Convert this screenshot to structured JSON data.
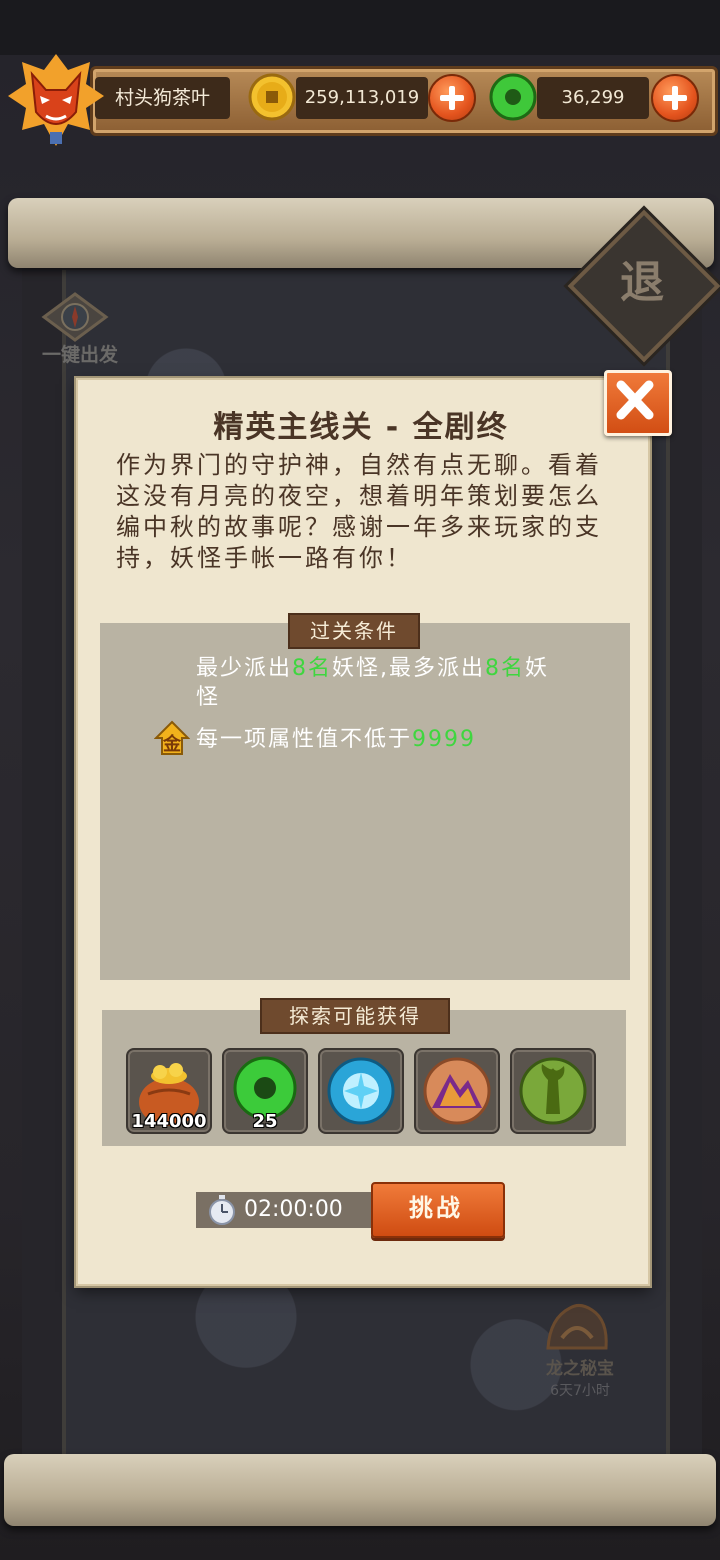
{
  "header": {
    "player_name": "村头狗茶叶",
    "coins": "259,113,019",
    "jade": "36,299"
  },
  "background": {
    "retreat_label": "退",
    "one_click_label": "一键出发",
    "event_title": "龙之秘宝",
    "event_timer": "6天7小时"
  },
  "modal": {
    "title": "精英主线关 - 全剧终",
    "description": "作为界门的守护神，自然有点无聊。看着这没有月亮的夜空，想着明年策划要怎么编中秋的故事呢？感谢一年多来玩家的支持，妖怪手帐一路有你！",
    "conditions_header": "过关条件",
    "condition1": {
      "part1": "最少派出",
      "count1": "8名",
      "part2": "妖怪,最多派出",
      "count2": "8名",
      "part3": "妖怪"
    },
    "condition2": {
      "text": "每一项属性值不低于",
      "value": "9999"
    },
    "gold_badge_label": "金",
    "rewards_header": "探索可能获得",
    "rewards": [
      {
        "icon": "coin-bag-icon",
        "quantity": "144000"
      },
      {
        "icon": "jade-ring-icon",
        "quantity": "25"
      },
      {
        "icon": "ice-orb-icon",
        "quantity": ""
      },
      {
        "icon": "mountain-orb-icon",
        "quantity": ""
      },
      {
        "icon": "tree-orb-icon",
        "quantity": ""
      }
    ],
    "timer": "02:00:00",
    "challenge_label": "挑战"
  },
  "colors": {
    "accent_orange": "#e4541e",
    "highlight_green": "#3fd63f",
    "panel_bg": "#efe6cf"
  }
}
